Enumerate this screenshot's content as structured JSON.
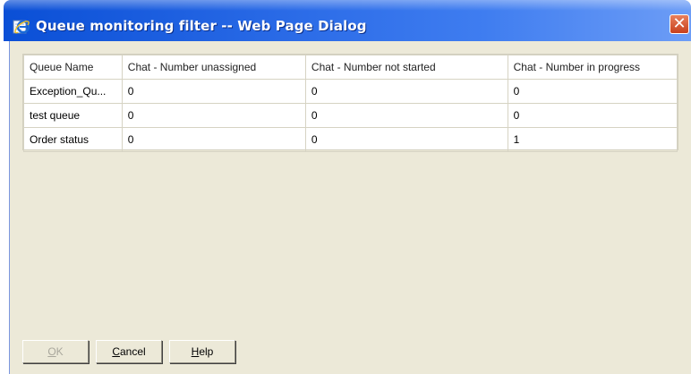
{
  "window": {
    "title": "Queue monitoring filter -- Web Page Dialog",
    "close_symbol": "✕"
  },
  "grid": {
    "columns": [
      "Queue Name",
      "Chat - Number unassigned",
      "Chat - Number not started",
      "Chat - Number in progress"
    ],
    "rows": [
      [
        "Exception_Qu...",
        "0",
        "0",
        "0"
      ],
      [
        "test queue",
        "0",
        "0",
        "0"
      ],
      [
        "Order status",
        "0",
        "0",
        "1"
      ]
    ]
  },
  "buttons": {
    "ok": {
      "mnemonic": "O",
      "rest": "K",
      "enabled": false
    },
    "cancel": {
      "mnemonic": "C",
      "rest": "ancel",
      "enabled": true
    },
    "help": {
      "mnemonic": "H",
      "rest": "elp",
      "enabled": true
    }
  },
  "colors": {
    "title_bar": "#0a4fd6",
    "dialog_background": "#ece9d8",
    "close_button": "#d45a2e"
  },
  "icons": {
    "title": "internet-explorer-icon",
    "close": "close-icon"
  }
}
